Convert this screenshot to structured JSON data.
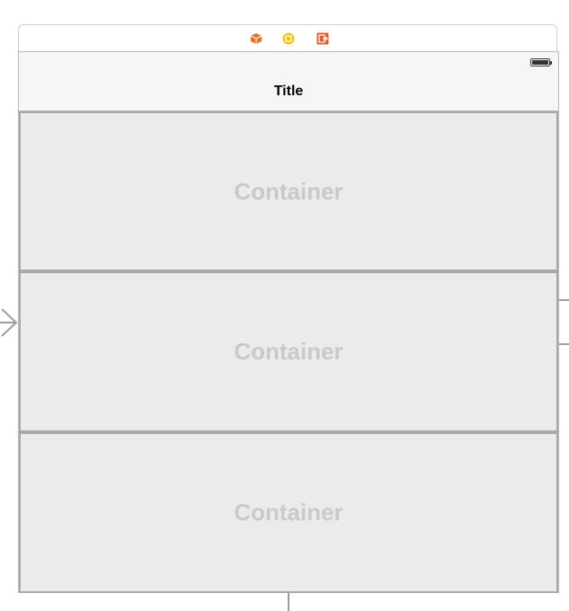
{
  "scene_dock": {
    "icons": [
      "view-controller-icon",
      "first-responder-icon",
      "exit-icon"
    ]
  },
  "nav_bar": {
    "title": "Title",
    "status_icon": "battery-icon"
  },
  "containers": [
    {
      "label": "Container"
    },
    {
      "label": "Container"
    },
    {
      "label": "Container"
    }
  ],
  "colors": {
    "container_bg": "#ebebeb",
    "container_label": "#c9c9c9",
    "nav_bg": "#f6f6f6",
    "view_controller_icon": "#e8702a",
    "first_responder_icon": "#f1c40f",
    "exit_icon": "#e8582a"
  }
}
